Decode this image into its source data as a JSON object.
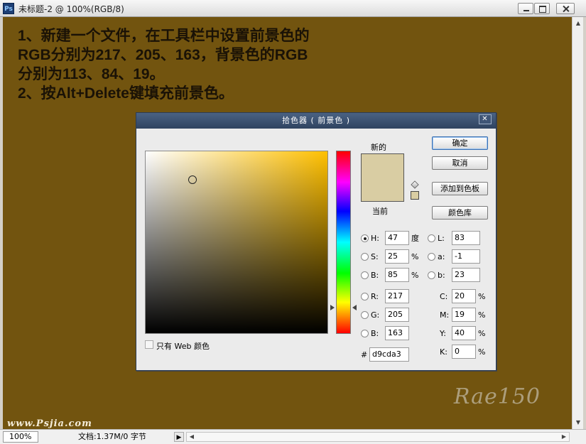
{
  "window": {
    "app_icon_text": "Ps",
    "title": "未标题-2 @ 100%(RGB/8)"
  },
  "canvas": {
    "instruction_lines": [
      "1、新建一个文件，在工具栏中设置前景色的",
      "RGB分别为217、205、163，背景色的RGB",
      "分别为113、84、19。",
      "2、按Alt+Delete键填充前景色。"
    ],
    "signature": "Rae150",
    "watermark": "www.Psjia.com",
    "background_color": "#72540f"
  },
  "status_bar": {
    "zoom": "100%",
    "doc_info": "文档:1.37M/0 字节"
  },
  "color_picker": {
    "title": "拾色器 ( 前景色 )",
    "new_label": "新的",
    "current_label": "当前",
    "new_color": "#d9cda3",
    "buttons": {
      "ok": "确定",
      "cancel": "取消",
      "add_to_swatches": "添加到色板",
      "color_libraries": "颜色库"
    },
    "hsb": {
      "h_label": "H:",
      "h_value": "47",
      "h_unit": "度",
      "s_label": "S:",
      "s_value": "25",
      "s_unit": "%",
      "b_label": "B:",
      "b_value": "85",
      "b_unit": "%"
    },
    "rgb": {
      "r_label": "R:",
      "r_value": "217",
      "g_label": "G:",
      "g_value": "205",
      "b_label": "B:",
      "b_value": "163"
    },
    "lab": {
      "l_label": "L:",
      "l_value": "83",
      "a_label": "a:",
      "a_value": "-1",
      "b_label": "b:",
      "b_value": "23"
    },
    "cmyk": {
      "c_label": "C:",
      "c_value": "20",
      "m_label": "M:",
      "m_value": "19",
      "y_label": "Y:",
      "y_value": "40",
      "k_label": "K:",
      "k_value": "0",
      "unit": "%"
    },
    "hex_label": "#",
    "hex_value": "d9cda3",
    "web_only_label": "只有 Web 颜色"
  }
}
